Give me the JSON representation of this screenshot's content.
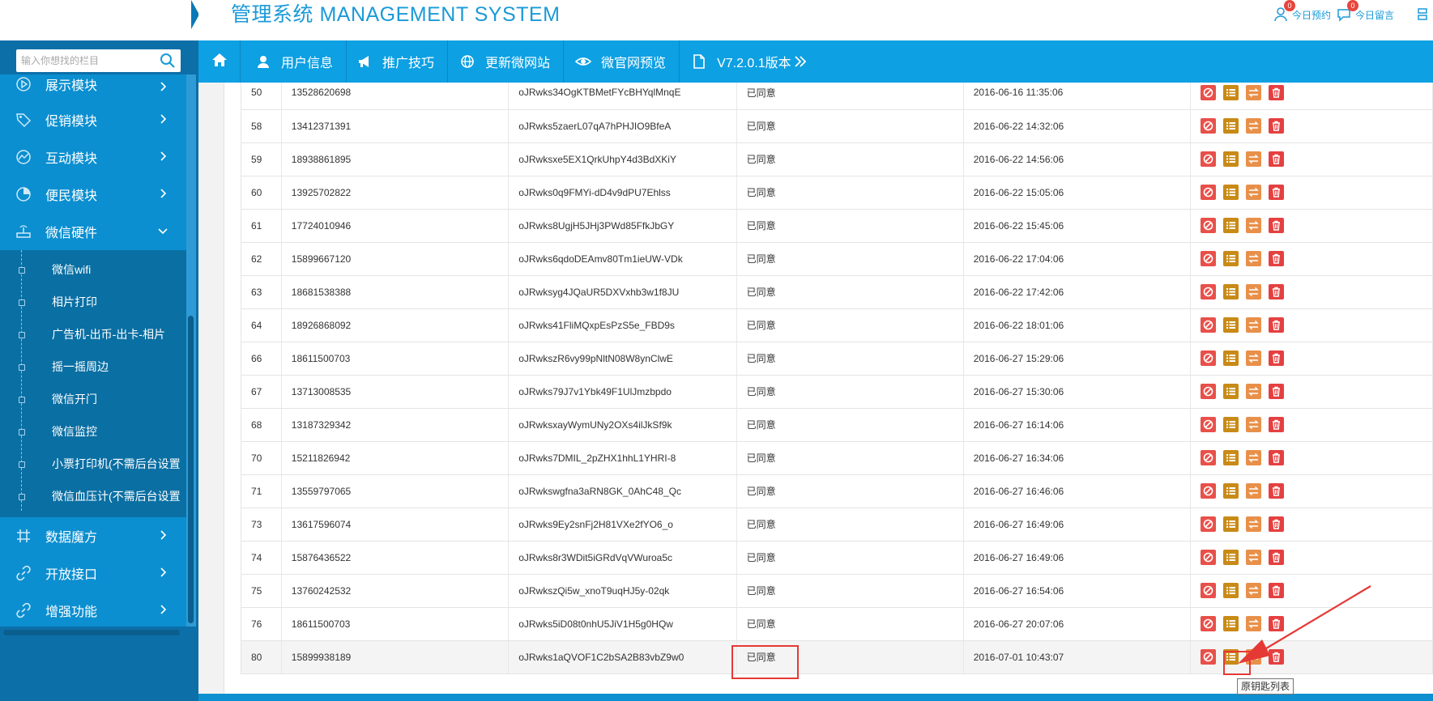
{
  "header": {
    "app_title": "管理系统 MANAGEMENT SYSTEM",
    "links": [
      {
        "label": "今日预约",
        "badge": "0"
      },
      {
        "label": "今日留言",
        "badge": "0"
      }
    ]
  },
  "search": {
    "placeholder": "输入你想找的栏目"
  },
  "sidebar": {
    "items": [
      {
        "label": "展示模块",
        "icon": "display-icon"
      },
      {
        "label": "促销模块",
        "icon": "tag-icon"
      },
      {
        "label": "互动模块",
        "icon": "trend-icon"
      },
      {
        "label": "便民模块",
        "icon": "pie-icon"
      },
      {
        "label": "微信硬件",
        "icon": "router-icon"
      }
    ],
    "submenu": [
      {
        "label": "微信wifi"
      },
      {
        "label": "相片打印"
      },
      {
        "label": "广告机-出币-出卡-相片"
      },
      {
        "label": "摇一摇周边"
      },
      {
        "label": "微信开门"
      },
      {
        "label": "微信监控"
      },
      {
        "label": "小票打印机(不需后台设置"
      },
      {
        "label": "微信血压计(不需后台设置"
      }
    ],
    "items_after": [
      {
        "label": "数据魔方",
        "icon": "grid-icon"
      },
      {
        "label": "开放接口",
        "icon": "link-icon"
      },
      {
        "label": "增强功能",
        "icon": "link-icon"
      }
    ]
  },
  "nav": {
    "items": [
      {
        "label": "用户信息",
        "icon": "user-icon"
      },
      {
        "label": "推广技巧",
        "icon": "megaphone-icon"
      },
      {
        "label": "更新微网站",
        "icon": "globe-icon"
      },
      {
        "label": "微官网预览",
        "icon": "eye-icon"
      },
      {
        "label": "V7.2.0.1版本",
        "icon": "file-icon"
      }
    ]
  },
  "table": {
    "rows": [
      {
        "id": "50",
        "phone": "13528620698",
        "openid": "oJRwks34OgKTBMetFYcBHYqlMnqE",
        "status": "已同意",
        "time": "2016-06-16 11:35:06"
      },
      {
        "id": "58",
        "phone": "13412371391",
        "openid": "oJRwks5zaerL07qA7hPHJIO9BfeA",
        "status": "已同意",
        "time": "2016-06-22 14:32:06"
      },
      {
        "id": "59",
        "phone": "18938861895",
        "openid": "oJRwksxe5EX1QrkUhpY4d3BdXKiY",
        "status": "已同意",
        "time": "2016-06-22 14:56:06"
      },
      {
        "id": "60",
        "phone": "13925702822",
        "openid": "oJRwks0q9FMYi-dD4v9dPU7Ehlss",
        "status": "已同意",
        "time": "2016-06-22 15:05:06"
      },
      {
        "id": "61",
        "phone": "17724010946",
        "openid": "oJRwks8UgjH5JHj3PWd85FfkJbGY",
        "status": "已同意",
        "time": "2016-06-22 15:45:06"
      },
      {
        "id": "62",
        "phone": "15899667120",
        "openid": "oJRwks6qdoDEAmv80Tm1ieUW-VDk",
        "status": "已同意",
        "time": "2016-06-22 17:04:06"
      },
      {
        "id": "63",
        "phone": "18681538388",
        "openid": "oJRwksyg4JQaUR5DXVxhb3w1f8JU",
        "status": "已同意",
        "time": "2016-06-22 17:42:06"
      },
      {
        "id": "64",
        "phone": "18926868092",
        "openid": "oJRwks41FliMQxpEsPzS5e_FBD9s",
        "status": "已同意",
        "time": "2016-06-22 18:01:06"
      },
      {
        "id": "66",
        "phone": "18611500703",
        "openid": "oJRwkszR6vy99pNltN08W8ynClwE",
        "status": "已同意",
        "time": "2016-06-27 15:29:06"
      },
      {
        "id": "67",
        "phone": "13713008535",
        "openid": "oJRwks79J7v1Ybk49F1UlJmzbpdo",
        "status": "已同意",
        "time": "2016-06-27 15:30:06"
      },
      {
        "id": "68",
        "phone": "13187329342",
        "openid": "oJRwksxayWymUNy2OXs4ilJkSf9k",
        "status": "已同意",
        "time": "2016-06-27 16:14:06"
      },
      {
        "id": "70",
        "phone": "15211826942",
        "openid": "oJRwks7DMIL_2pZHX1hhL1YHRI-8",
        "status": "已同意",
        "time": "2016-06-27 16:34:06"
      },
      {
        "id": "71",
        "phone": "13559797065",
        "openid": "oJRwkswgfna3aRN8GK_0AhC48_Qc",
        "status": "已同意",
        "time": "2016-06-27 16:46:06"
      },
      {
        "id": "73",
        "phone": "13617596074",
        "openid": "oJRwks9Ey2snFj2H81VXe2fYO6_o",
        "status": "已同意",
        "time": "2016-06-27 16:49:06"
      },
      {
        "id": "74",
        "phone": "15876436522",
        "openid": "oJRwks8r3WDit5iGRdVqVWuroa5c",
        "status": "已同意",
        "time": "2016-06-27 16:49:06"
      },
      {
        "id": "75",
        "phone": "13760242532",
        "openid": "oJRwkszQi5w_xnoT9uqHJ5y-02qk",
        "status": "已同意",
        "time": "2016-06-27 16:54:06"
      },
      {
        "id": "76",
        "phone": "18611500703",
        "openid": "oJRwks5iD08t0nhU5JiV1H5g0HQw",
        "status": "已同意",
        "time": "2016-06-27 20:07:06"
      },
      {
        "id": "80",
        "phone": "15899938189",
        "openid": "oJRwks1aQVOF1C2bSA2B83vbZ9w0",
        "status": "已同意",
        "time": "2016-07-01 10:43:07"
      }
    ]
  },
  "tooltip": {
    "text": "原钥匙列表"
  },
  "colors": {
    "brand": "#0da0e3",
    "sidebar": "#0b8fd0",
    "highlight": "#e53935"
  }
}
